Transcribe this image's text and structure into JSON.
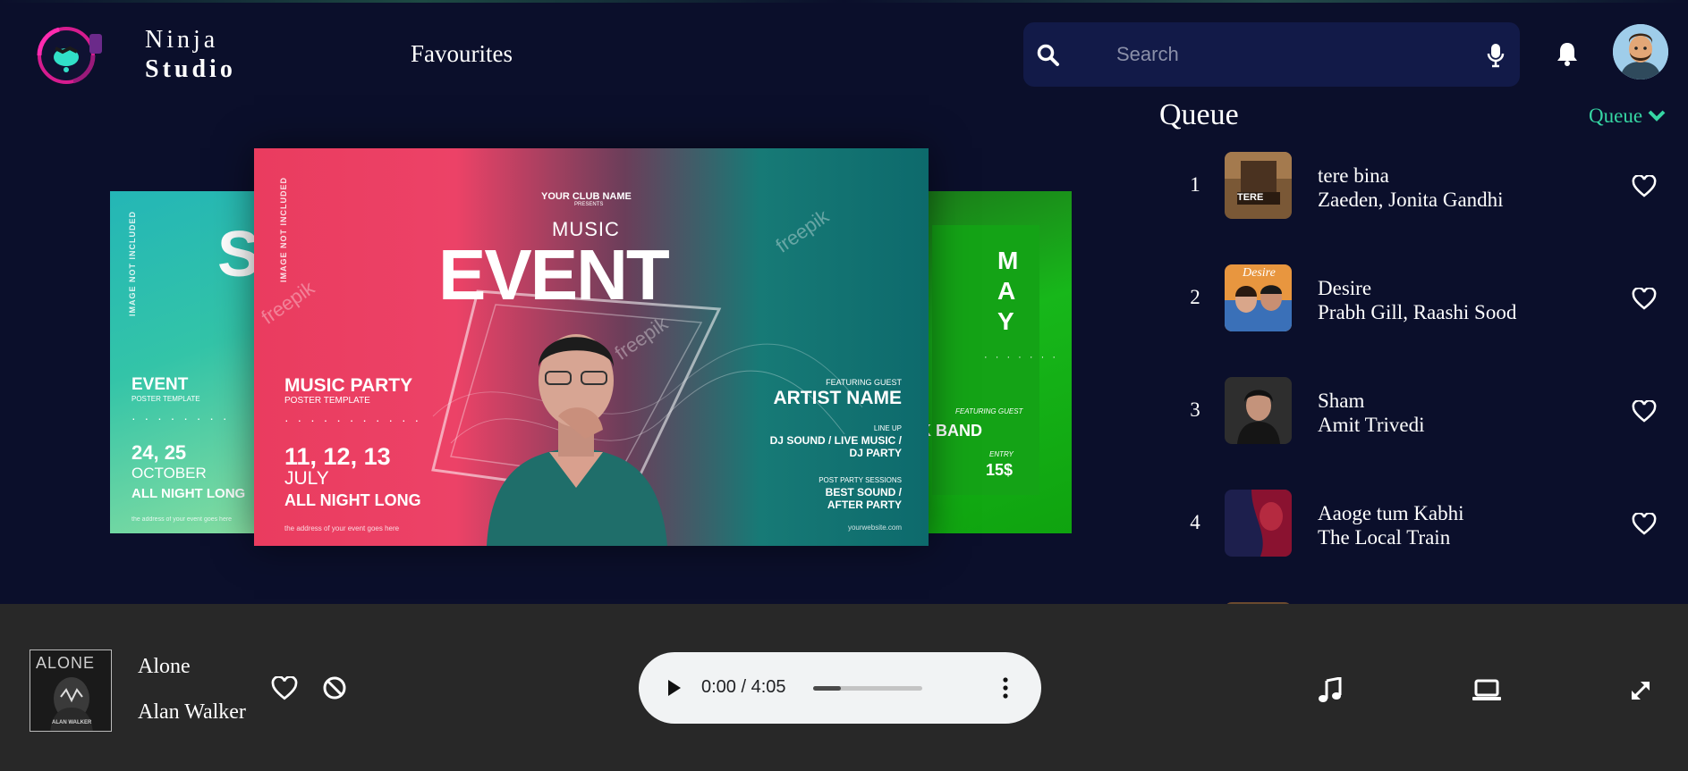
{
  "app": {
    "brand_line1": "Ninja",
    "brand_line2": "Studio",
    "accent_color": "#36d6a3",
    "background_color": "#0b0f2b",
    "player_background_color": "#282828"
  },
  "nav": {
    "favourites_label": "Favourites"
  },
  "search": {
    "placeholder": "Search",
    "value": "",
    "icon": "search-icon",
    "mic_icon": "microphone-icon"
  },
  "header_icons": {
    "notifications": "bell-icon",
    "profile": "avatar"
  },
  "carousel": {
    "left_card": {
      "vertical_note": "IMAGE NOT INCLUDED",
      "big_letter": "S",
      "heading": "EVENT",
      "sub": "POSTER TEMPLATE",
      "dates": "24, 25",
      "month": "OCTOBER",
      "tagline": "ALL NIGHT LONG",
      "footer": "the address of your event goes here"
    },
    "main_card": {
      "vertical_note": "IMAGE NOT INCLUDED",
      "club": "YOUR CLUB NAME",
      "presents": "PRESENTS",
      "music": "MUSIC",
      "event": "EVENT",
      "party": "MUSIC PARTY",
      "party_sub": "POSTER TEMPLATE",
      "dates": "11, 12, 13",
      "month": "JULY",
      "tagline": "ALL NIGHT LONG",
      "address": "the address of your event goes here",
      "featuring": "FEATURING GUEST",
      "artist": "ARTIST NAME",
      "lineup": "LINE UP",
      "lineup_1": "DJ SOUND / LIVE MUSIC /",
      "lineup_2": "DJ PARTY",
      "post_party": "POST PARTY SESSIONS",
      "post_1": "BEST SOUND /",
      "post_2": "AFTER PARTY",
      "website": "yourwebsite.com",
      "watermark": "freepik"
    },
    "right_card": {
      "m1": "M",
      "m2": "A",
      "m3": "Y",
      "featuring": "FEATURING GUEST",
      "band": "ROCK BAND",
      "entry": "ENTRY",
      "price": "15$"
    }
  },
  "queue": {
    "title": "Queue",
    "toggle_label": "Queue",
    "items": [
      {
        "index": "1",
        "title": "tere bina",
        "artist": "Zaeden, Jonita Gandhi",
        "thumb_text": "TERE",
        "thumb_color": "#6b4a2e"
      },
      {
        "index": "2",
        "title": "Desire",
        "artist": "Prabh Gill, Raashi Sood",
        "thumb_text": "Desire",
        "thumb_color": "#e08a3a"
      },
      {
        "index": "3",
        "title": "Sham",
        "artist": "Amit Trivedi",
        "thumb_text": "",
        "thumb_color": "#2b2b2b"
      },
      {
        "index": "4",
        "title": "Aaoge tum Kabhi",
        "artist": "The Local Train",
        "thumb_text": "",
        "thumb_color": "#5a1428"
      }
    ]
  },
  "player": {
    "cover_title": "ALONE",
    "cover_artist": "ALAN WALKER",
    "title": "Alone",
    "artist": "Alan Walker",
    "time": "0:00 / 4:05",
    "progress": 0.25,
    "controls": [
      "music-note-icon",
      "laptop-icon",
      "expand-icon"
    ]
  }
}
